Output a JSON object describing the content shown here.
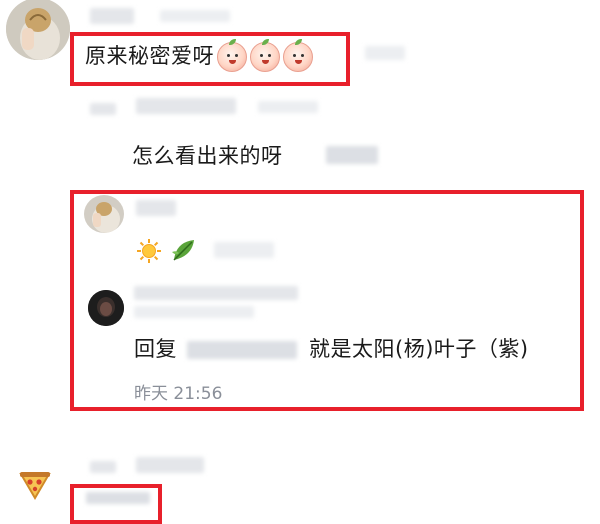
{
  "comments": [
    {
      "text": "原来秘密爱呀",
      "emoji": [
        "peach-emoji",
        "peach-emoji",
        "peach-emoji"
      ]
    },
    {
      "text": "怎么看出来的呀"
    },
    {
      "emoji": [
        "sun-emoji",
        "leaf-emoji"
      ]
    },
    {
      "reply_prefix": "回复",
      "text": "就是太阳(杨)叶子（紫)",
      "time": "昨天 21:56"
    }
  ],
  "colors": {
    "highlight": "#e8202b",
    "timestamp": "#8a8f99"
  }
}
